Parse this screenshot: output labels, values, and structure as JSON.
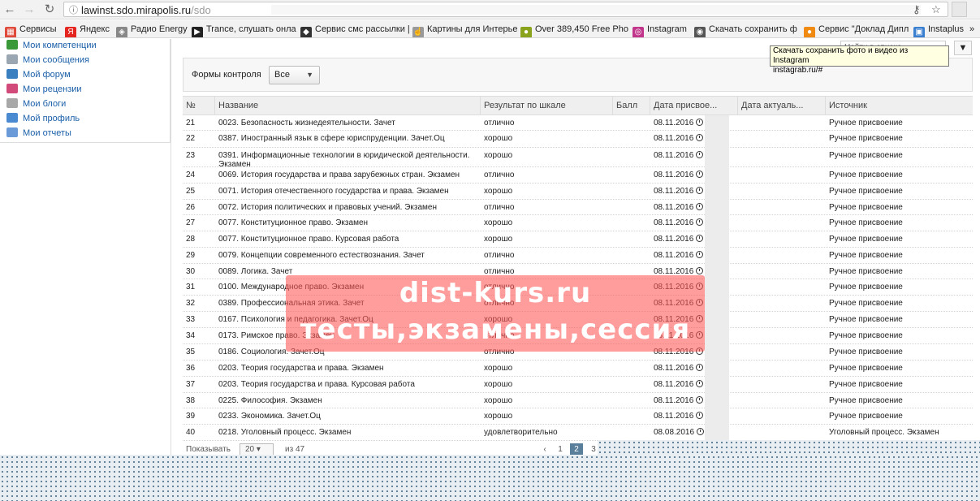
{
  "browser": {
    "url_host": "lawinst.sdo.mirapolis.ru",
    "url_path": "/sdo",
    "bookmarks": [
      {
        "label": "Сервисы",
        "icon": "apps-grid-icon",
        "color": "#e04a3a"
      },
      {
        "label": "Яндекс",
        "icon": "yandex-icon",
        "color": "#e52620"
      },
      {
        "label": "Радио Energy",
        "icon": "cube-icon",
        "color": "#888888"
      },
      {
        "label": "Trance, слушать онла",
        "icon": "play-icon",
        "color": "#222222"
      },
      {
        "label": "Сервис смс рассылки |",
        "icon": "spy-icon",
        "color": "#333333"
      },
      {
        "label": "Картины для Интерье",
        "icon": "thumb-icon",
        "color": "#999999"
      },
      {
        "label": "Over 389,450 Free Pho",
        "icon": "lime-icon",
        "color": "#8aa31c"
      },
      {
        "label": "Instagram",
        "icon": "instagram-icon",
        "color": "#c1358a"
      },
      {
        "label": "Скачать сохранить ф",
        "icon": "eye-icon",
        "color": "#555555"
      },
      {
        "label": "Сервис \"Доклад Дипл",
        "icon": "orange-circle-icon",
        "color": "#f08a12"
      },
      {
        "label": "Instaplus",
        "icon": "instaplus-icon",
        "color": "#3b7fd0"
      }
    ],
    "more": "»"
  },
  "sidebar": {
    "items": [
      {
        "label": "Мои компетенции",
        "color": "#3a9a3a"
      },
      {
        "label": "Мои сообщения",
        "color": "#9aa6b2"
      },
      {
        "label": "Мой форум",
        "color": "#3a7fc0"
      },
      {
        "label": "Мои рецензии",
        "color": "#d24a7a"
      },
      {
        "label": "Мои блоги",
        "color": "#a8a8a8"
      },
      {
        "label": "Мой профиль",
        "color": "#4a8ad0"
      },
      {
        "label": "Мои отчеты",
        "color": "#6a9ad8"
      }
    ]
  },
  "search": {
    "placeholder": "Найти в списке"
  },
  "tooltip": {
    "line1": "Скачать сохранить фото и видео из Instagram",
    "line2": "instagrab.ru/#"
  },
  "filter": {
    "label": "Формы контроля",
    "value": "Все"
  },
  "table": {
    "headers": [
      "№",
      "Название",
      "Результат по шкале",
      "Балл",
      "Дата присвое...",
      "Дата актуаль...",
      "Источник"
    ],
    "rows": [
      {
        "n": "21",
        "name": "0023. Безопасность жизнедеятельности. Зачет",
        "result": "отлично",
        "date": "08.11.2016",
        "source": "Ручное присвоение"
      },
      {
        "n": "22",
        "name": "0387. Иностранный язык в сфере юриспруденции. Зачет.Оц",
        "result": "хорошо",
        "date": "08.11.2016",
        "source": "Ручное присвоение"
      },
      {
        "n": "23",
        "name": "0391. Информационные технологии в юридической деятельности. Экзамен",
        "result": "хорошо",
        "date": "08.11.2016",
        "source": "Ручное присвоение"
      },
      {
        "n": "24",
        "name": "0069. История государства и права зарубежных стран. Экзамен",
        "result": "отлично",
        "date": "08.11.2016",
        "source": "Ручное присвоение"
      },
      {
        "n": "25",
        "name": "0071. История отечественного государства и права. Экзамен",
        "result": "хорошо",
        "date": "08.11.2016",
        "source": "Ручное присвоение"
      },
      {
        "n": "26",
        "name": "0072. История политических и правовых учений. Экзамен",
        "result": "отлично",
        "date": "08.11.2016",
        "source": "Ручное присвоение"
      },
      {
        "n": "27",
        "name": "0077. Конституционное право. Экзамен",
        "result": "хорошо",
        "date": "08.11.2016",
        "source": "Ручное присвоение"
      },
      {
        "n": "28",
        "name": "0077. Конституционное право. Курсовая работа",
        "result": "хорошо",
        "date": "08.11.2016",
        "source": "Ручное присвоение"
      },
      {
        "n": "29",
        "name": "0079. Концепции современного естествознания. Зачет",
        "result": "отлично",
        "date": "08.11.2016",
        "source": "Ручное присвоение"
      },
      {
        "n": "30",
        "name": "0089. Логика. Зачет",
        "result": "отлично",
        "date": "08.11.2016",
        "source": "Ручное присвоение"
      },
      {
        "n": "31",
        "name": "0100. Международное право. Экзамен",
        "result": "отлично",
        "date": "08.11.2016",
        "source": "Ручное присвоение"
      },
      {
        "n": "32",
        "name": "0389. Профессиональная этика. Зачет",
        "result": "отлично",
        "date": "08.11.2016",
        "source": "Ручное присвоение"
      },
      {
        "n": "33",
        "name": "0167. Психология и педагогика. Зачет.Оц",
        "result": "хорошо",
        "date": "08.11.2016",
        "source": "Ручное присвоение"
      },
      {
        "n": "34",
        "name": "0173. Римское право. Экзамен",
        "result": "отлично",
        "date": "08.11.2016",
        "source": "Ручное присвоение"
      },
      {
        "n": "35",
        "name": "0186. Социология. Зачет.Оц",
        "result": "отлично",
        "date": "08.11.2016",
        "source": "Ручное присвоение"
      },
      {
        "n": "36",
        "name": "0203. Теория государства и права. Экзамен",
        "result": "хорошо",
        "date": "08.11.2016",
        "source": "Ручное присвоение"
      },
      {
        "n": "37",
        "name": "0203. Теория государства и права. Курсовая работа",
        "result": "хорошо",
        "date": "08.11.2016",
        "source": "Ручное присвоение"
      },
      {
        "n": "38",
        "name": "0225. Философия. Экзамен",
        "result": "хорошо",
        "date": "08.11.2016",
        "source": "Ручное присвоение"
      },
      {
        "n": "39",
        "name": "0233. Экономика. Зачет.Оц",
        "result": "хорошо",
        "date": "08.11.2016",
        "source": "Ручное присвоение"
      },
      {
        "n": "40",
        "name": "0218. Уголовный процесс. Экзамен",
        "result": "удовлетворительно",
        "date": "08.08.2016",
        "source": "Уголовный процесс. Экзамен"
      }
    ]
  },
  "pager": {
    "show_label": "Показывать",
    "page_size": "20",
    "of_label": "из 47",
    "prev": "‹",
    "pages": [
      "1",
      "2",
      "3"
    ],
    "current": "2"
  },
  "watermark": {
    "line1": "dist-kurs.ru",
    "line2": "тесты,экзамены,сессия"
  }
}
